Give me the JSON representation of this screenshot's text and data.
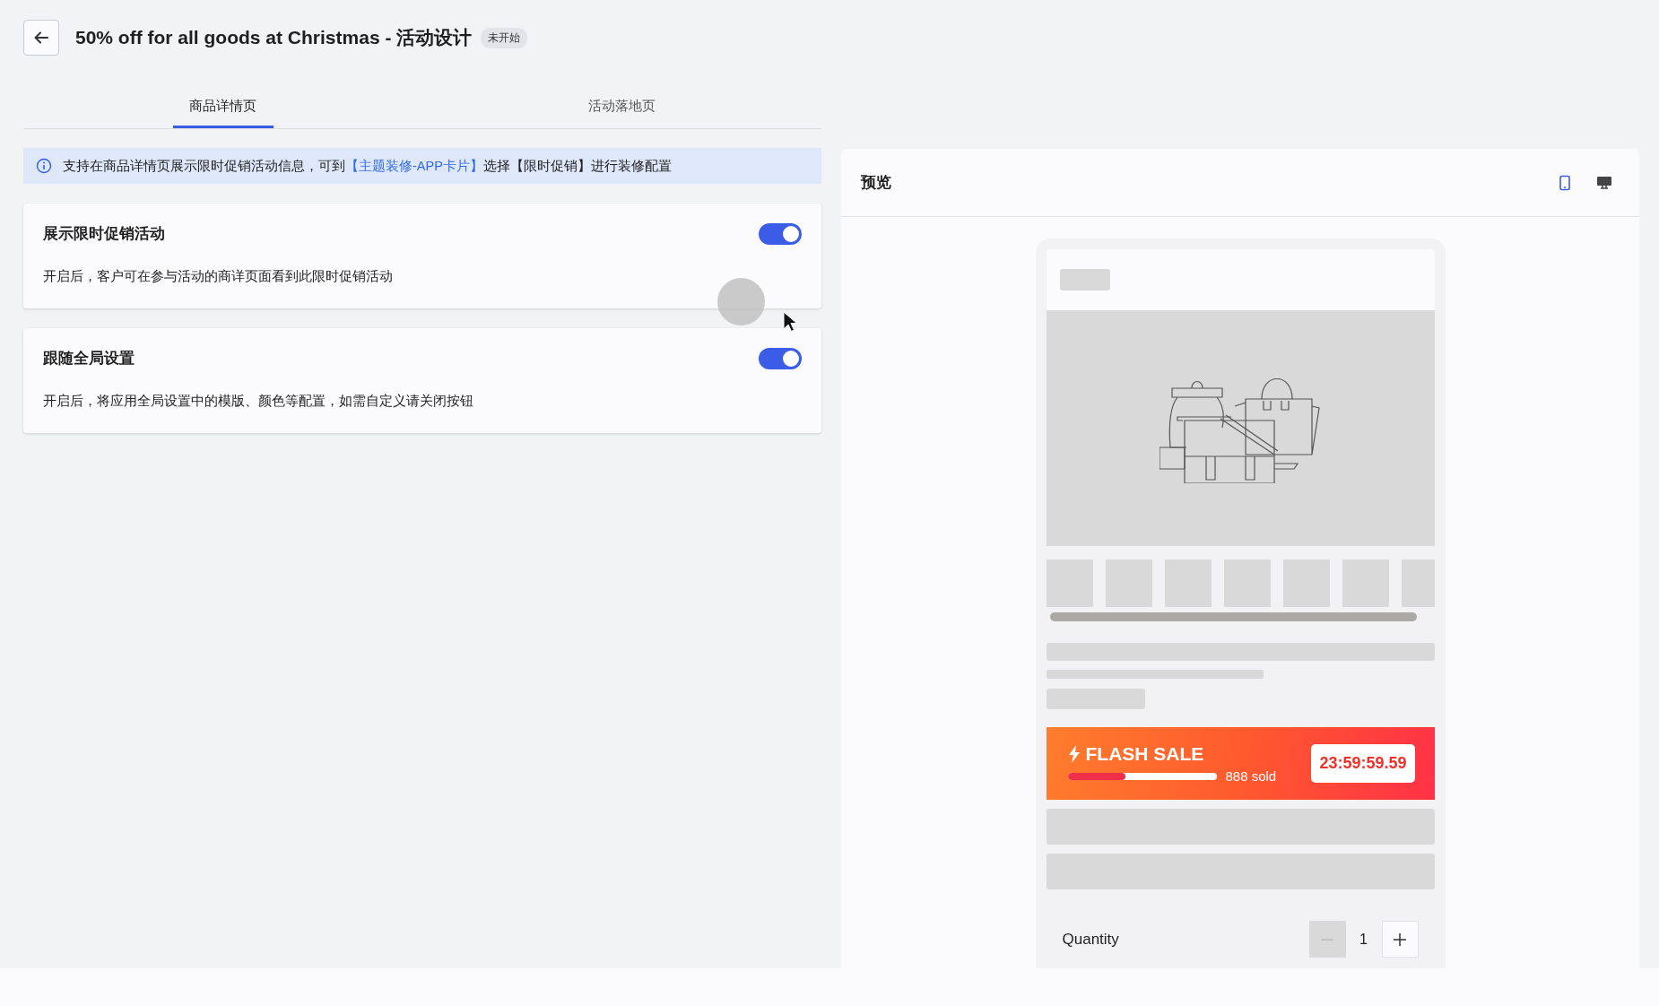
{
  "header": {
    "title": "50% off for all goods at Christmas - 活动设计",
    "status_badge": "未开始"
  },
  "tabs": [
    {
      "label": "商品详情页",
      "selected": true
    },
    {
      "label": "活动落地页",
      "selected": false
    }
  ],
  "notice": {
    "text_before": "支持在商品详情页展示限时促销活动信息，可到",
    "link": "【主题装修-APP卡片】",
    "text_after": "选择【限时促销】进行装修配置"
  },
  "settings": [
    {
      "title": "展示限时促销活动",
      "description": "开启后，客户可在参与活动的商详页面看到此限时促销活动",
      "on": true
    },
    {
      "title": "跟随全局设置",
      "description": "开启后，将应用全局设置中的模版、颜色等配置，如需自定义请关闭按钮",
      "on": true
    }
  ],
  "preview": {
    "title": "预览",
    "devices": [
      {
        "kind": "mobile",
        "selected": true
      },
      {
        "kind": "desktop",
        "selected": false
      }
    ],
    "flash_sale": {
      "title": "FLASH SALE",
      "level": 0.39,
      "sold": "888 sold",
      "countdown": "23:59:59.59"
    },
    "quantity": {
      "label": "Quantity",
      "value": "1",
      "minus_disabled": true
    }
  }
}
